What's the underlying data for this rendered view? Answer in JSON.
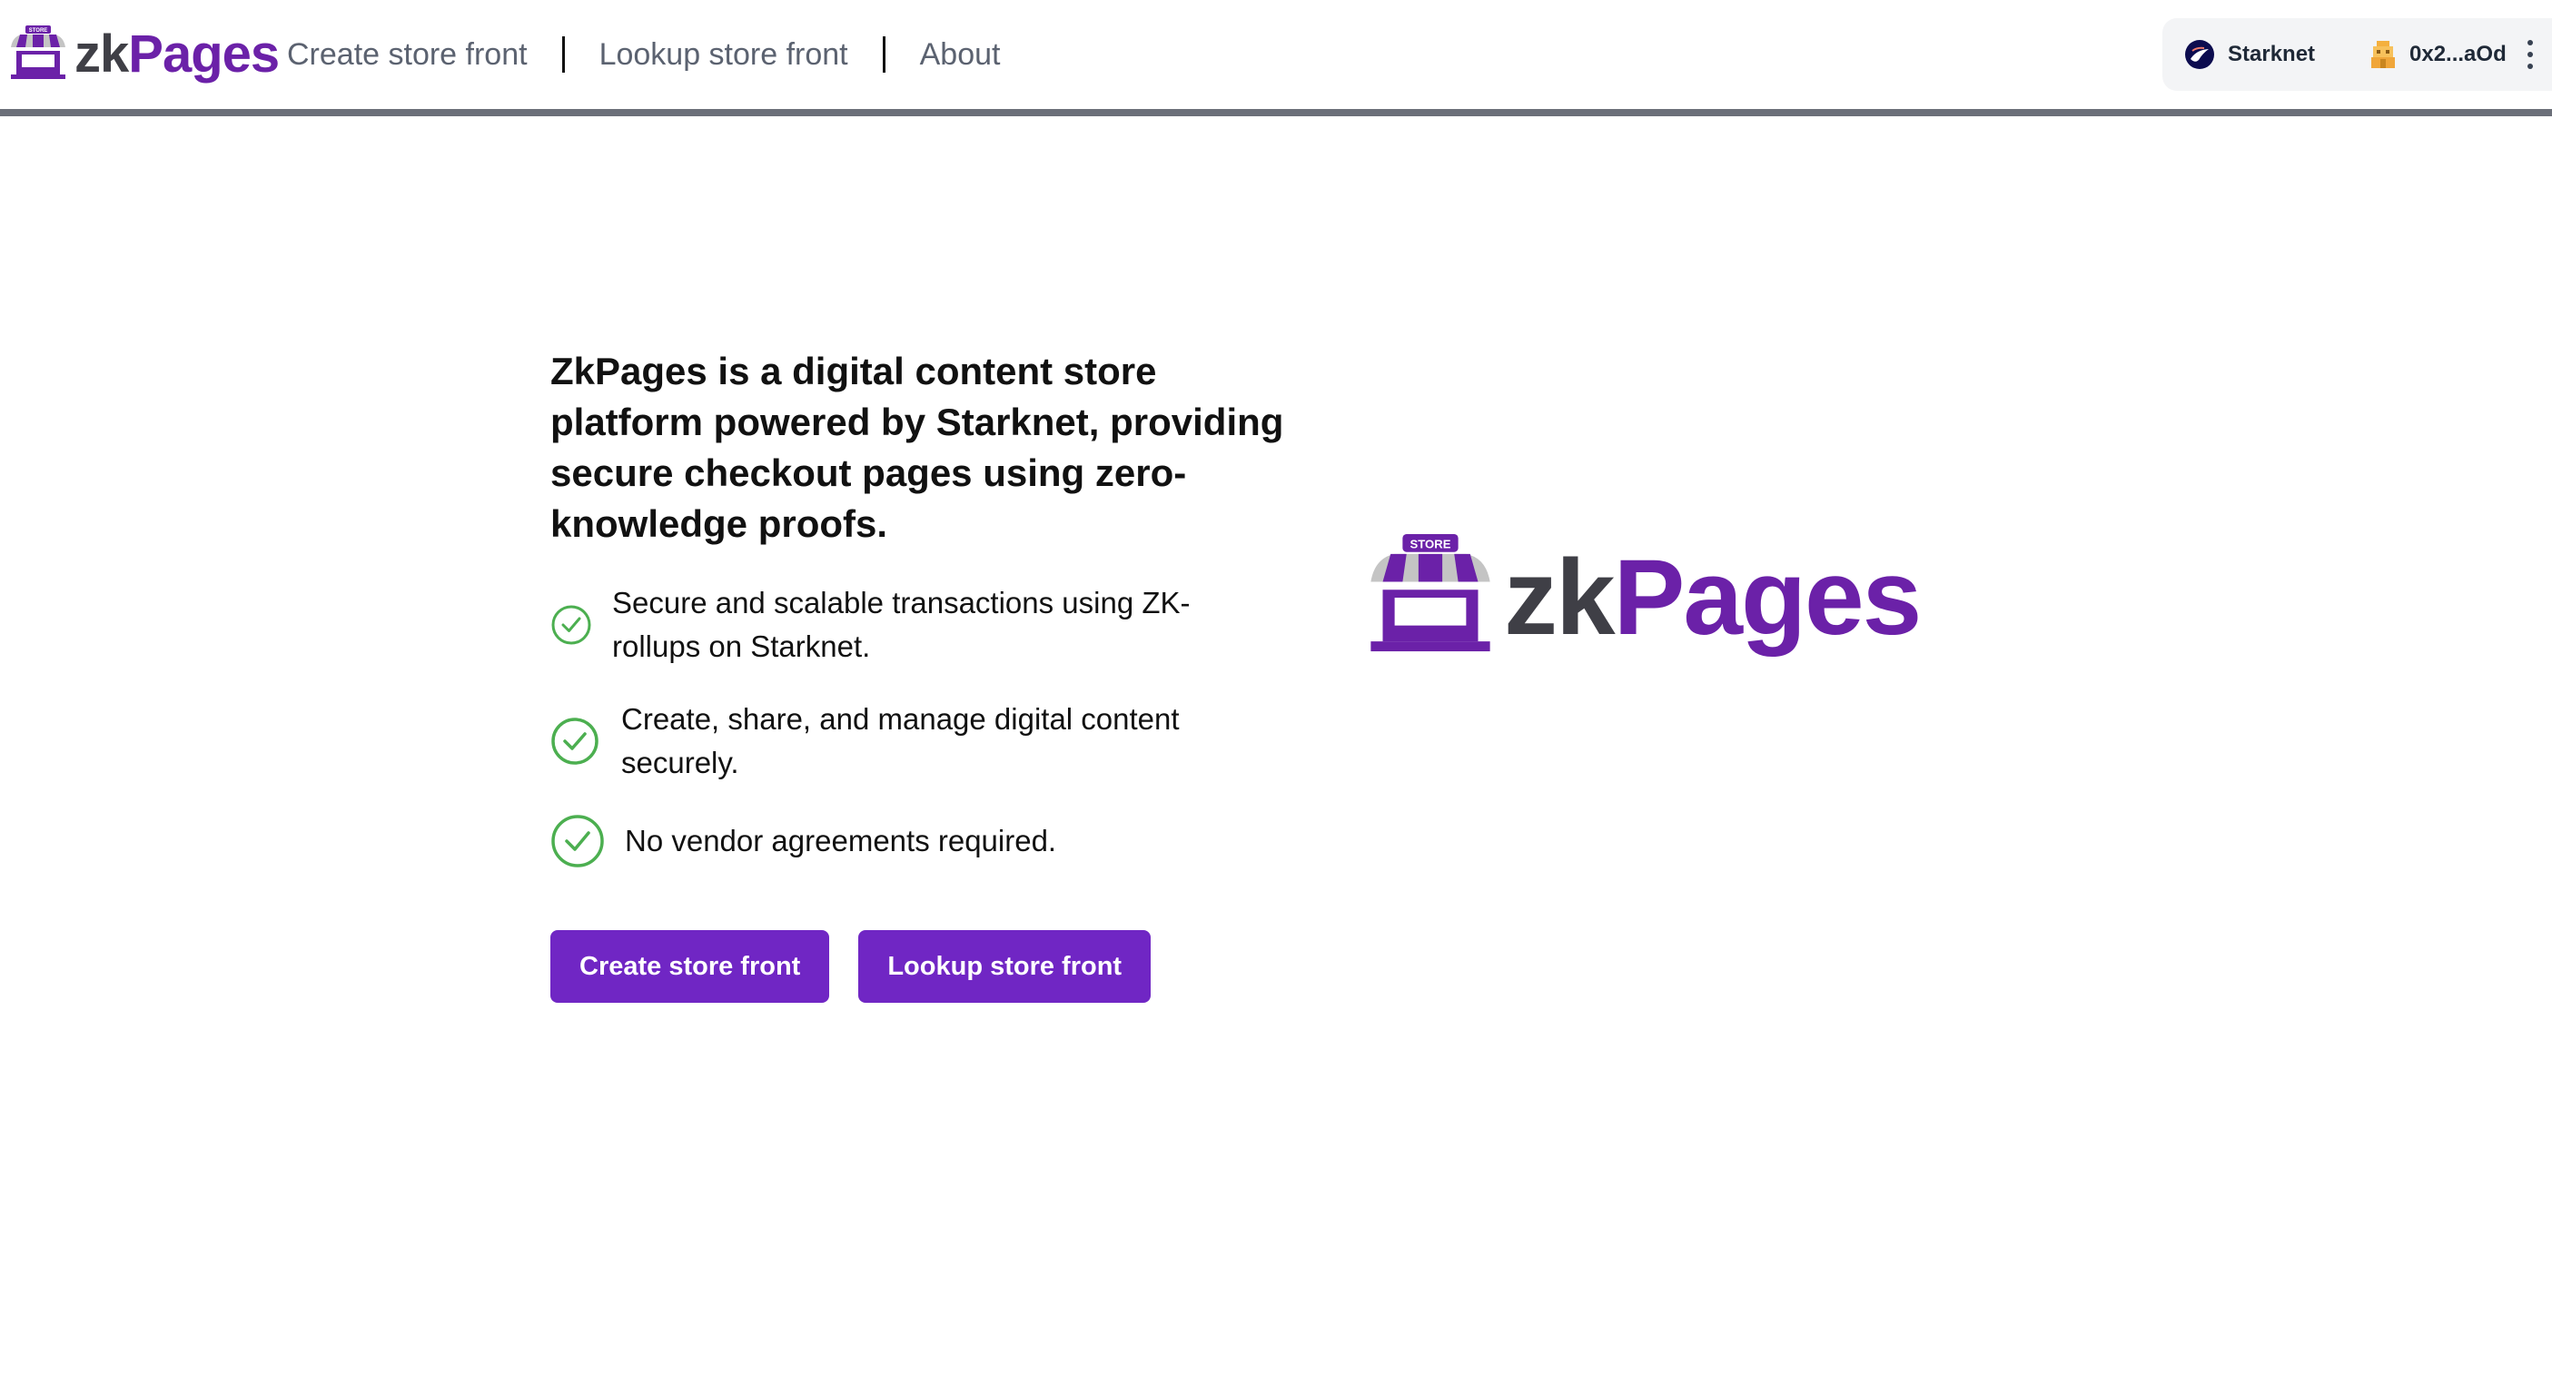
{
  "header": {
    "brand": {
      "zk": "zk",
      "pages": "Pages",
      "store_sign": "STORE"
    },
    "nav_links": [
      {
        "label": "Create store front"
      },
      {
        "label": "Lookup store front"
      },
      {
        "label": "About"
      }
    ],
    "wallet": {
      "chain_label": "Starknet",
      "chain_icon": "starknet-icon",
      "account_label": "0x2...aOd",
      "account_icon": "avatar-icon",
      "menu_icon": "kebab-menu-icon"
    }
  },
  "hero": {
    "title": "ZkPages is a digital content store platform powered by Starknet, providing secure checkout pages using zero-knowledge proofs.",
    "features": [
      {
        "text": "Secure and scalable transactions using ZK-rollups on Starknet."
      },
      {
        "text": "Create, share, and manage digital content securely."
      },
      {
        "text": "No vendor agreements required."
      }
    ],
    "buttons": {
      "create": "Create store front",
      "lookup": "Lookup store front"
    },
    "logo": {
      "zk": "zk",
      "pages": "Pages",
      "store_sign": "STORE"
    }
  },
  "colors": {
    "brand_purple": "#6b21a8",
    "button_purple": "#7026c4",
    "check_green": "#4caf50",
    "header_border": "#6b6f79"
  }
}
